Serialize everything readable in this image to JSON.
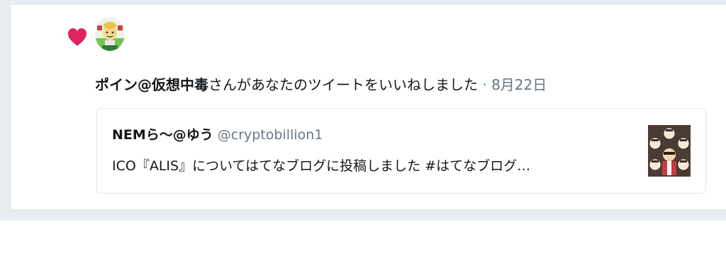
{
  "notification": {
    "user_name": "ポイン@仮想中毒",
    "action_text": "さんがあなたのツイートをいいねしました",
    "separator": "·",
    "date": "8月22日",
    "icon": "heart-icon",
    "heart_color": "#e0245e"
  },
  "quoted_tweet": {
    "author_name": "NEMら～@ゆう",
    "author_handle": "@cryptobillion1",
    "text": "ICO『ALIS』についてはてなブログに投稿しました #はてなブログ…"
  }
}
